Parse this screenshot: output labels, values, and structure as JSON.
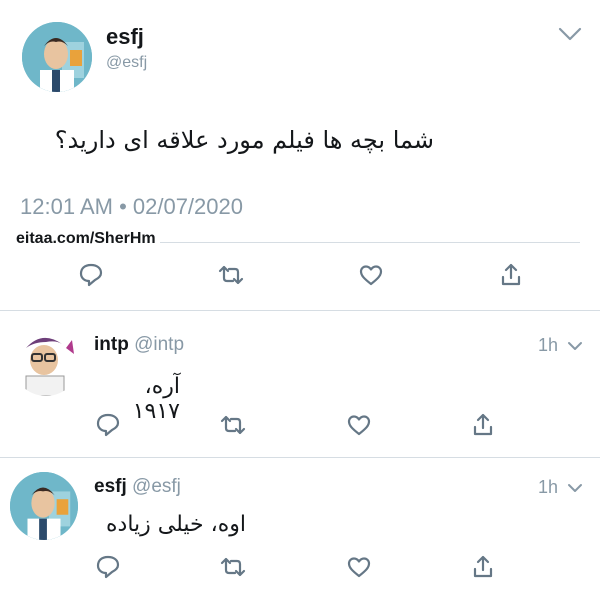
{
  "main_tweet": {
    "display_name": "esfj",
    "handle": "@esfj",
    "text": "شما بچه ها فیلم مورد علاقه ای دارید؟",
    "timestamp": "12:01 AM • 02/07/2020",
    "watermark": "eitaa.com/SherHm",
    "avatar_icon": "cartoon-avatar-esfj"
  },
  "replies": [
    {
      "display_name": "intp",
      "handle": "@intp",
      "time": "1h",
      "text": "آره، ۱۹۱۷",
      "avatar_icon": "cartoon-avatar-intp"
    },
    {
      "display_name": "esfj",
      "handle": "@esfj",
      "time": "1h",
      "text": "اوه، خیلی زیاده",
      "avatar_icon": "cartoon-avatar-esfj"
    }
  ],
  "actions": [
    "reply-icon",
    "retweet-icon",
    "like-icon",
    "share-icon"
  ],
  "colors": {
    "text": "#14171a",
    "muted": "#8899a6",
    "divider": "#d6dde3",
    "avatar_bg": "#6fb7c9"
  }
}
